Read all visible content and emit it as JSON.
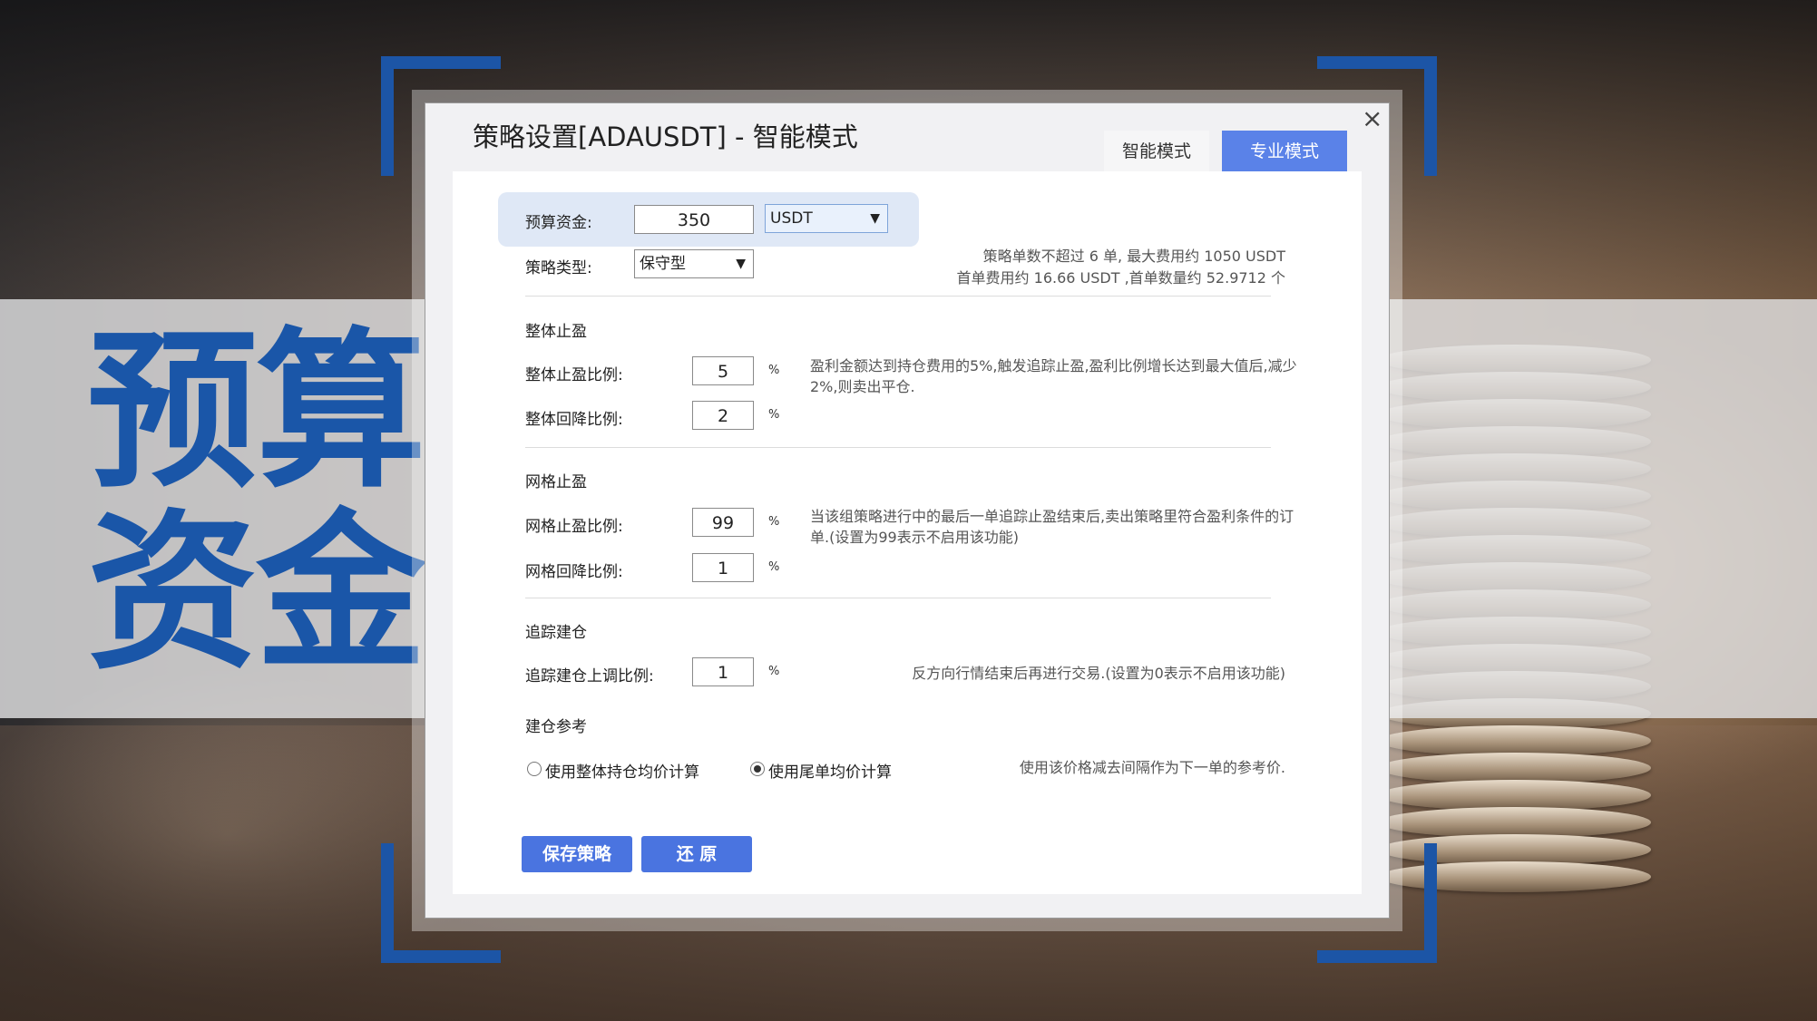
{
  "hero": {
    "line1": "预算",
    "line2": "资金"
  },
  "dialog": {
    "title": "策略设置[ADAUSDT] - 智能模式",
    "close_label": "×",
    "tabs": {
      "smart": "智能模式",
      "pro": "专业模式"
    },
    "budget": {
      "label": "预算资金:",
      "value": "350",
      "currency": "USDT"
    },
    "strategy_type": {
      "label": "策略类型:",
      "value": "保守型"
    },
    "summary": {
      "line1": "策略单数不超过 6 单, 最大费用约 1050 USDT",
      "line2": "首单费用约 16.66 USDT ,首单数量约 52.9712 个"
    },
    "overall": {
      "title": "整体止盈",
      "tp_label": "整体止盈比例:",
      "tp_value": "5",
      "tp_unit": "%",
      "pb_label": "整体回降比例:",
      "pb_value": "2",
      "pb_unit": "%",
      "hint": "盈利金额达到持仓费用的5%,触发追踪止盈,盈利比例增长达到最大值后,减少2%,则卖出平仓."
    },
    "grid": {
      "title": "网格止盈",
      "tp_label": "网格止盈比例:",
      "tp_value": "99",
      "tp_unit": "%",
      "pb_label": "网格回降比例:",
      "pb_value": "1",
      "pb_unit": "%",
      "hint": "当该组策略进行中的最后一单追踪止盈结束后,卖出策略里符合盈利条件的订单.(设置为99表示不启用该功能)"
    },
    "trailing": {
      "title": "追踪建仓",
      "label": "追踪建仓上调比例:",
      "value": "1",
      "unit": "%",
      "hint": "反方向行情结束后再进行交易.(设置为0表示不启用该功能)"
    },
    "reference": {
      "title": "建仓参考",
      "option1": "使用整体持仓均价计算",
      "option2": "使用尾单均价计算",
      "selected": "option2",
      "hint": "使用该价格减去间隔作为下一单的参考价."
    },
    "buttons": {
      "save": "保存策略",
      "reset": "还 原"
    }
  },
  "colors": {
    "brand_blue": "#1a56a8",
    "button_blue": "#4a74e0",
    "tab_blue": "#5a82e8"
  }
}
